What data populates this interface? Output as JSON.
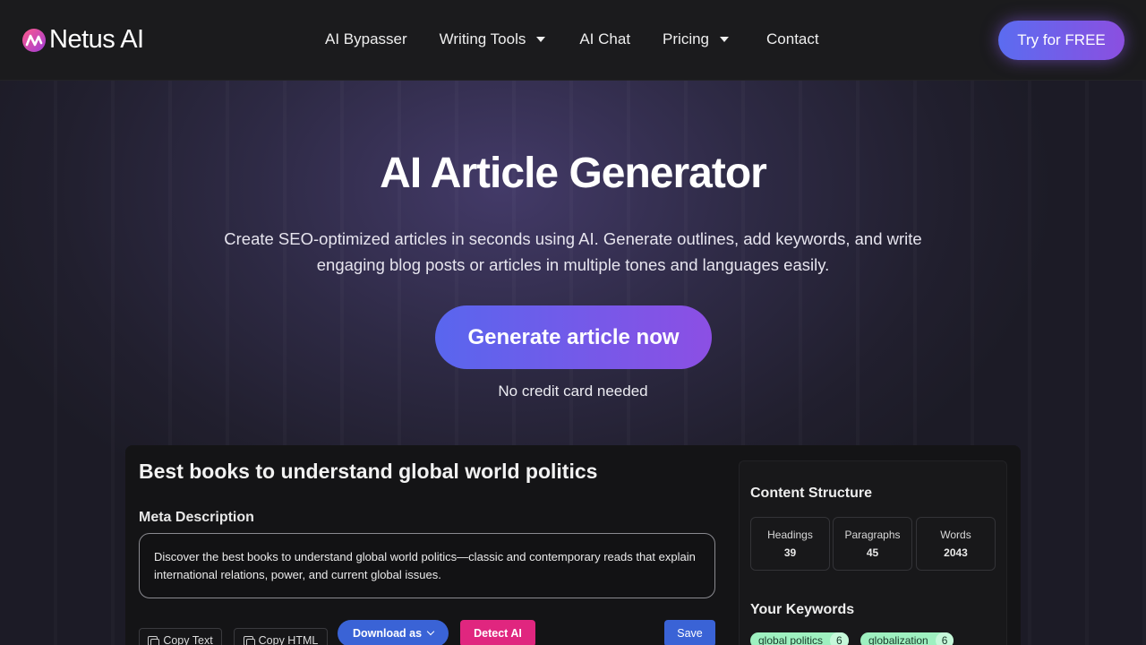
{
  "nav": {
    "brand": "Netus AI",
    "links": [
      {
        "label": "AI Bypasser",
        "dropdown": false
      },
      {
        "label": "Writing Tools",
        "dropdown": true
      },
      {
        "label": "AI Chat",
        "dropdown": false
      },
      {
        "label": "Pricing",
        "dropdown": true
      },
      {
        "label": "Contact",
        "dropdown": false
      }
    ],
    "cta": "Try for FREE"
  },
  "hero": {
    "title": "AI Article Generator",
    "subtitle_line1": "Create SEO-optimized articles in seconds using AI. Generate outlines, add keywords, and write",
    "subtitle_line2": "engaging blog posts or articles in multiple tones and languages easily.",
    "cta": "Generate article now",
    "note": "No credit card needed"
  },
  "app": {
    "article_title": "Best books to understand global world politics",
    "meta_label": "Meta Description",
    "meta_text": "Discover the best books to understand global world politics—classic and contemporary reads that explain international relations, power, and current global issues.",
    "buttons": {
      "copy_text": "Copy Text",
      "copy_html": "Copy HTML",
      "download": "Download as",
      "detect": "Detect AI",
      "save": "Save"
    },
    "structure": {
      "title": "Content Structure",
      "stats": [
        {
          "label": "Headings",
          "value": "39"
        },
        {
          "label": "Paragraphs",
          "value": "45"
        },
        {
          "label": "Words",
          "value": "2043"
        }
      ]
    },
    "keywords": {
      "title": "Your Keywords",
      "items": [
        {
          "label": "global politics",
          "count": "6"
        },
        {
          "label": "globalization",
          "count": "6"
        }
      ]
    }
  },
  "colors": {
    "accent_start": "#5b6cf0",
    "accent_end": "#8b4fe0",
    "detect": "#e0267f",
    "primary_blue": "#3a63d6",
    "keyword_chip": "#9ef0c0"
  }
}
